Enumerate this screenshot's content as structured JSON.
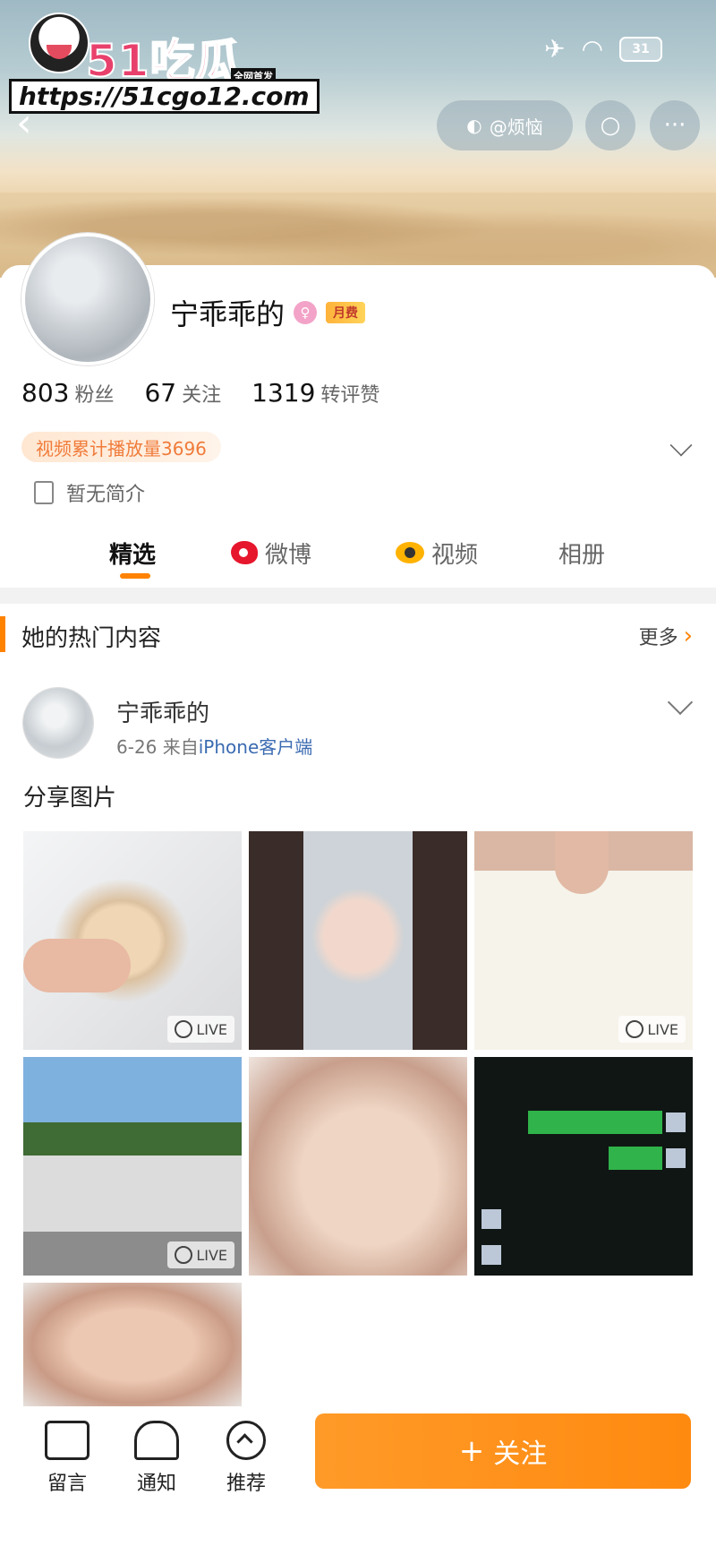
{
  "watermark": {
    "brand": "51吃瓜",
    "tag": "全网首发",
    "url": "https://51cgo12.com"
  },
  "status": {
    "battery": "31",
    "airplane_icon": "airplane-icon",
    "wifi_icon": "wifi-icon"
  },
  "topbar": {
    "pill_label": "@烦恼"
  },
  "profile": {
    "name": "宁乖乖的",
    "vip_label": "月费",
    "stats": [
      {
        "num": "803",
        "label": "粉丝"
      },
      {
        "num": "67",
        "label": "关注"
      },
      {
        "num": "1319",
        "label": "转评赞"
      }
    ],
    "views_tag": "视频累计播放量3696",
    "bio": "暂无简介"
  },
  "tabs": [
    {
      "label": "精选"
    },
    {
      "label": "微博"
    },
    {
      "label": "视频"
    },
    {
      "label": "相册"
    }
  ],
  "hot": {
    "title": "她的热门内容",
    "more": "更多"
  },
  "post": {
    "name": "宁乖乖的",
    "date": "6-26",
    "source_prefix": "来自",
    "source": "iPhone客户端",
    "text": "分享图片",
    "live_label": "LIVE"
  },
  "bottom": {
    "items": [
      {
        "label": "留言"
      },
      {
        "label": "通知"
      },
      {
        "label": "推荐"
      }
    ],
    "follow_plus": "+",
    "follow_label": "关注"
  },
  "colors": {
    "accent": "#ff8200",
    "weibo_red": "#e6162d",
    "link_blue": "#3b6bb1"
  }
}
